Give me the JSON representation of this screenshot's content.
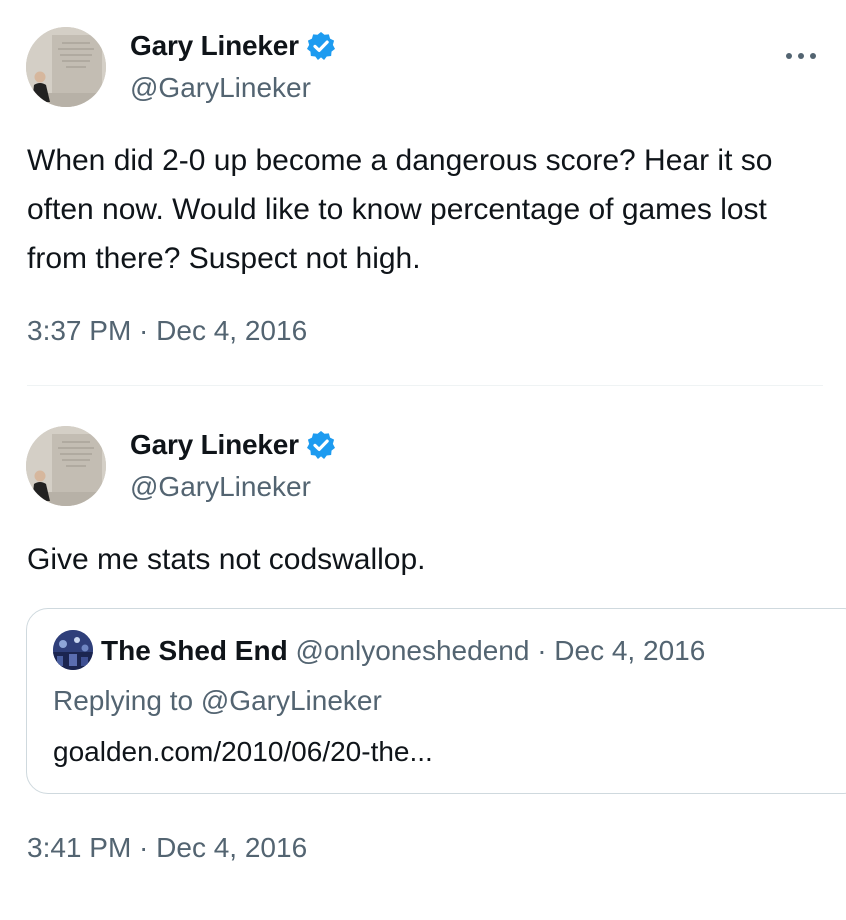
{
  "tweets": [
    {
      "author": "Gary Lineker",
      "handle": "@GaryLineker",
      "text": "When did 2-0 up become a dangerous score? Hear it so often now. Would like to know percentage of games lost from there? Suspect not high.",
      "time": "3:37 PM · Dec 4, 2016"
    },
    {
      "author": "Gary Lineker",
      "handle": "@GaryLineker",
      "text": "Give me stats not codswallop.",
      "time": "3:41 PM · Dec 4, 2016",
      "quote": {
        "author": "The Shed End",
        "meta": "@onlyoneshedend · Dec 4, 2016",
        "replying": "Replying to @GaryLineker",
        "link": "goalden.com/2010/06/20-the..."
      }
    }
  ],
  "icons": {
    "verified": "verified-badge-icon",
    "more": "more-options-icon"
  },
  "colors": {
    "verified": "#1d9bf0",
    "secondary_text": "#536471",
    "primary_text": "#0f1419",
    "border": "#cfd9de"
  }
}
